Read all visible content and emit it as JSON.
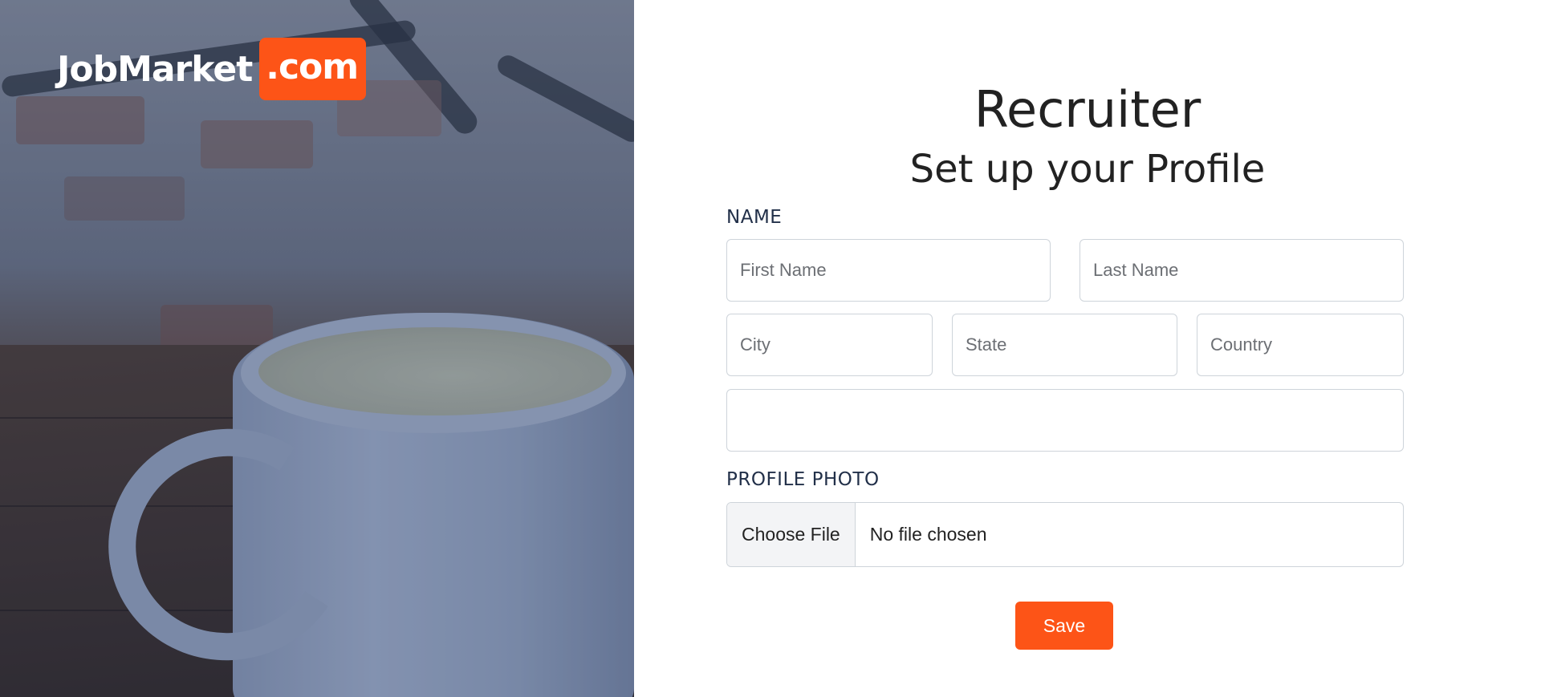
{
  "brand": {
    "name": "JobMarket",
    "suffix": ".com",
    "accent_color": "#fd5417"
  },
  "page": {
    "title": "Recruiter",
    "subtitle": "Set up your Profile"
  },
  "form": {
    "name_section_label": "NAME",
    "first_name": {
      "value": "",
      "placeholder": "First Name"
    },
    "last_name": {
      "value": "",
      "placeholder": "Last Name"
    },
    "city": {
      "value": "",
      "placeholder": "City"
    },
    "state": {
      "value": "",
      "placeholder": "State"
    },
    "country": {
      "value": "",
      "placeholder": "Country"
    },
    "extra_field": {
      "value": "",
      "placeholder": ""
    },
    "photo_section_label": "PROFILE PHOTO",
    "file_button_label": "Choose File",
    "file_status": "No file chosen",
    "save_label": "Save"
  }
}
